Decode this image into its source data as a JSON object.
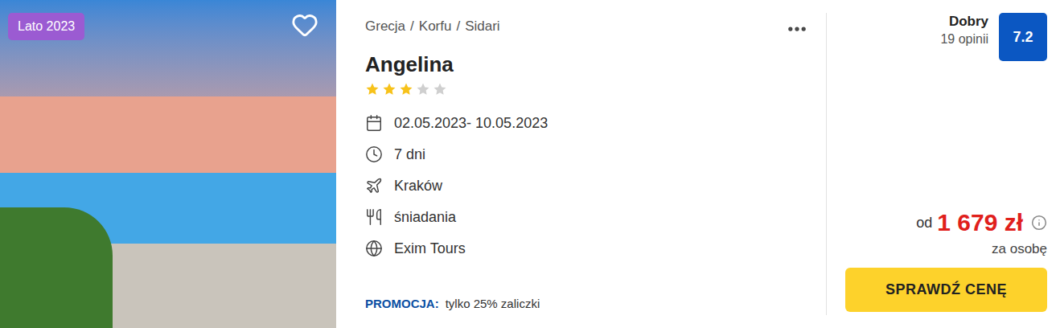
{
  "photo": {
    "badge": "Lato 2023",
    "favorite": false
  },
  "breadcrumb": {
    "items": [
      "Grecja",
      "Korfu",
      "Sidari"
    ],
    "separator": "/"
  },
  "hotel": {
    "name": "Angelina",
    "stars": 3,
    "stars_total": 5
  },
  "details": [
    {
      "kind": "date",
      "text": "02.05.2023- 10.05.2023"
    },
    {
      "kind": "duration",
      "text": "7 dni"
    },
    {
      "kind": "departure",
      "text": "Kraków"
    },
    {
      "kind": "board",
      "text": "śniadania"
    },
    {
      "kind": "operator",
      "text": "Exim Tours"
    }
  ],
  "promo": {
    "label": "PROMOCJA:",
    "text": "tylko 25% zaliczki"
  },
  "rating": {
    "label": "Dobry",
    "reviews": "19 opinii",
    "score": "7.2"
  },
  "price": {
    "prefix": "od",
    "amount": "1 679 zł",
    "suffix": "za osobę"
  },
  "button": {
    "label": "SPRAWDŹ CENĘ"
  }
}
